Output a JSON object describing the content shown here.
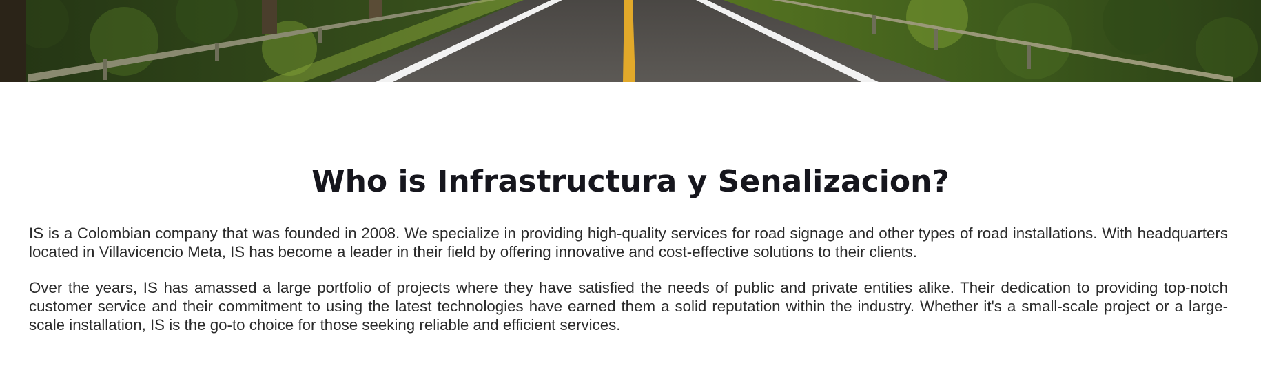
{
  "hero": {
    "image": "road-through-forest"
  },
  "about": {
    "title": "Who is Infrastructura y Senalizacion?",
    "paragraphs": [
      "IS is a Colombian company that was founded in 2008. We specialize in providing high-quality services for road signage and other types of road installations. With headquarters located in Villavicencio Meta, IS has become a leader in their field by offering innovative and cost-effective solutions to their clients.",
      "Over the years, IS has amassed a large portfolio of projects where they have satisfied the needs of public and private entities alike. Their dedication to providing top-notch customer service and their commitment to using the latest technologies have earned them a solid reputation within the industry. Whether it's a small-scale project or a large-scale installation, IS is the go-to choice for those seeking reliable and efficient services."
    ]
  },
  "colors": {
    "title": "#16161d",
    "body_text": "#2a2a2a",
    "road_center_line": "#e2a92a",
    "background": "#ffffff"
  }
}
